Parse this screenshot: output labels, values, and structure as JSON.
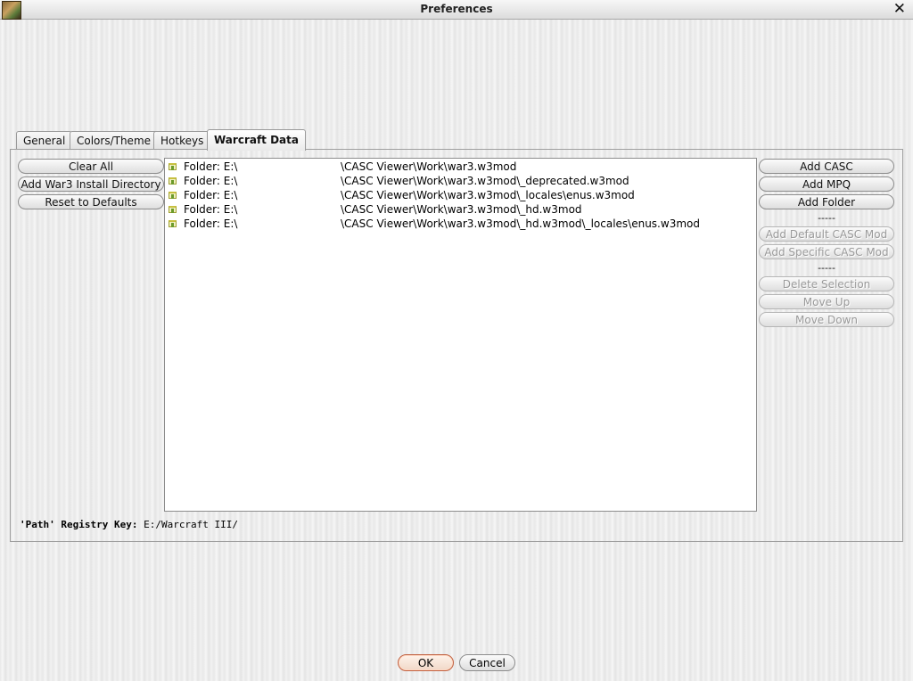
{
  "window": {
    "title": "Preferences",
    "close_glyph": "✕",
    "app_icon": "warcraft-app-icon"
  },
  "tabs": [
    {
      "label": "General",
      "active": false
    },
    {
      "label": "Colors/Theme",
      "active": false
    },
    {
      "label": "Hotkeys",
      "active": false
    },
    {
      "label": "Warcraft Data",
      "active": true
    }
  ],
  "left_buttons": {
    "clear_all": "Clear All",
    "add_install_dir": "Add War3 Install Directory",
    "reset_defaults": "Reset to Defaults"
  },
  "right_buttons": {
    "add_casc": "Add CASC",
    "add_mpq": "Add MPQ",
    "add_folder": "Add Folder",
    "sep1": "-----",
    "add_default_casc_mod": "Add Default CASC Mod",
    "add_specific_casc_mod": "Add Specific CASC Mod",
    "sep2": "-----",
    "delete_selection": "Delete Selection",
    "move_up": "Move Up",
    "move_down": "Move Down"
  },
  "data_sources": [
    {
      "prefix": "Folder: E:\\",
      "path": "\\CASC Viewer\\Work\\war3.w3mod"
    },
    {
      "prefix": "Folder: E:\\",
      "path": "\\CASC Viewer\\Work\\war3.w3mod\\_deprecated.w3mod"
    },
    {
      "prefix": "Folder: E:\\",
      "path": "\\CASC Viewer\\Work\\war3.w3mod\\_locales\\enus.w3mod"
    },
    {
      "prefix": "Folder: E:\\",
      "path": "\\CASC Viewer\\Work\\war3.w3mod\\_hd.w3mod"
    },
    {
      "prefix": "Folder: E:\\",
      "path": "\\CASC Viewer\\Work\\war3.w3mod\\_hd.w3mod\\_locales\\enus.w3mod"
    }
  ],
  "registry": {
    "label": "'Path' Registry Key:",
    "value": "E:/Warcraft III/"
  },
  "footer": {
    "ok": "OK",
    "cancel": "Cancel"
  }
}
